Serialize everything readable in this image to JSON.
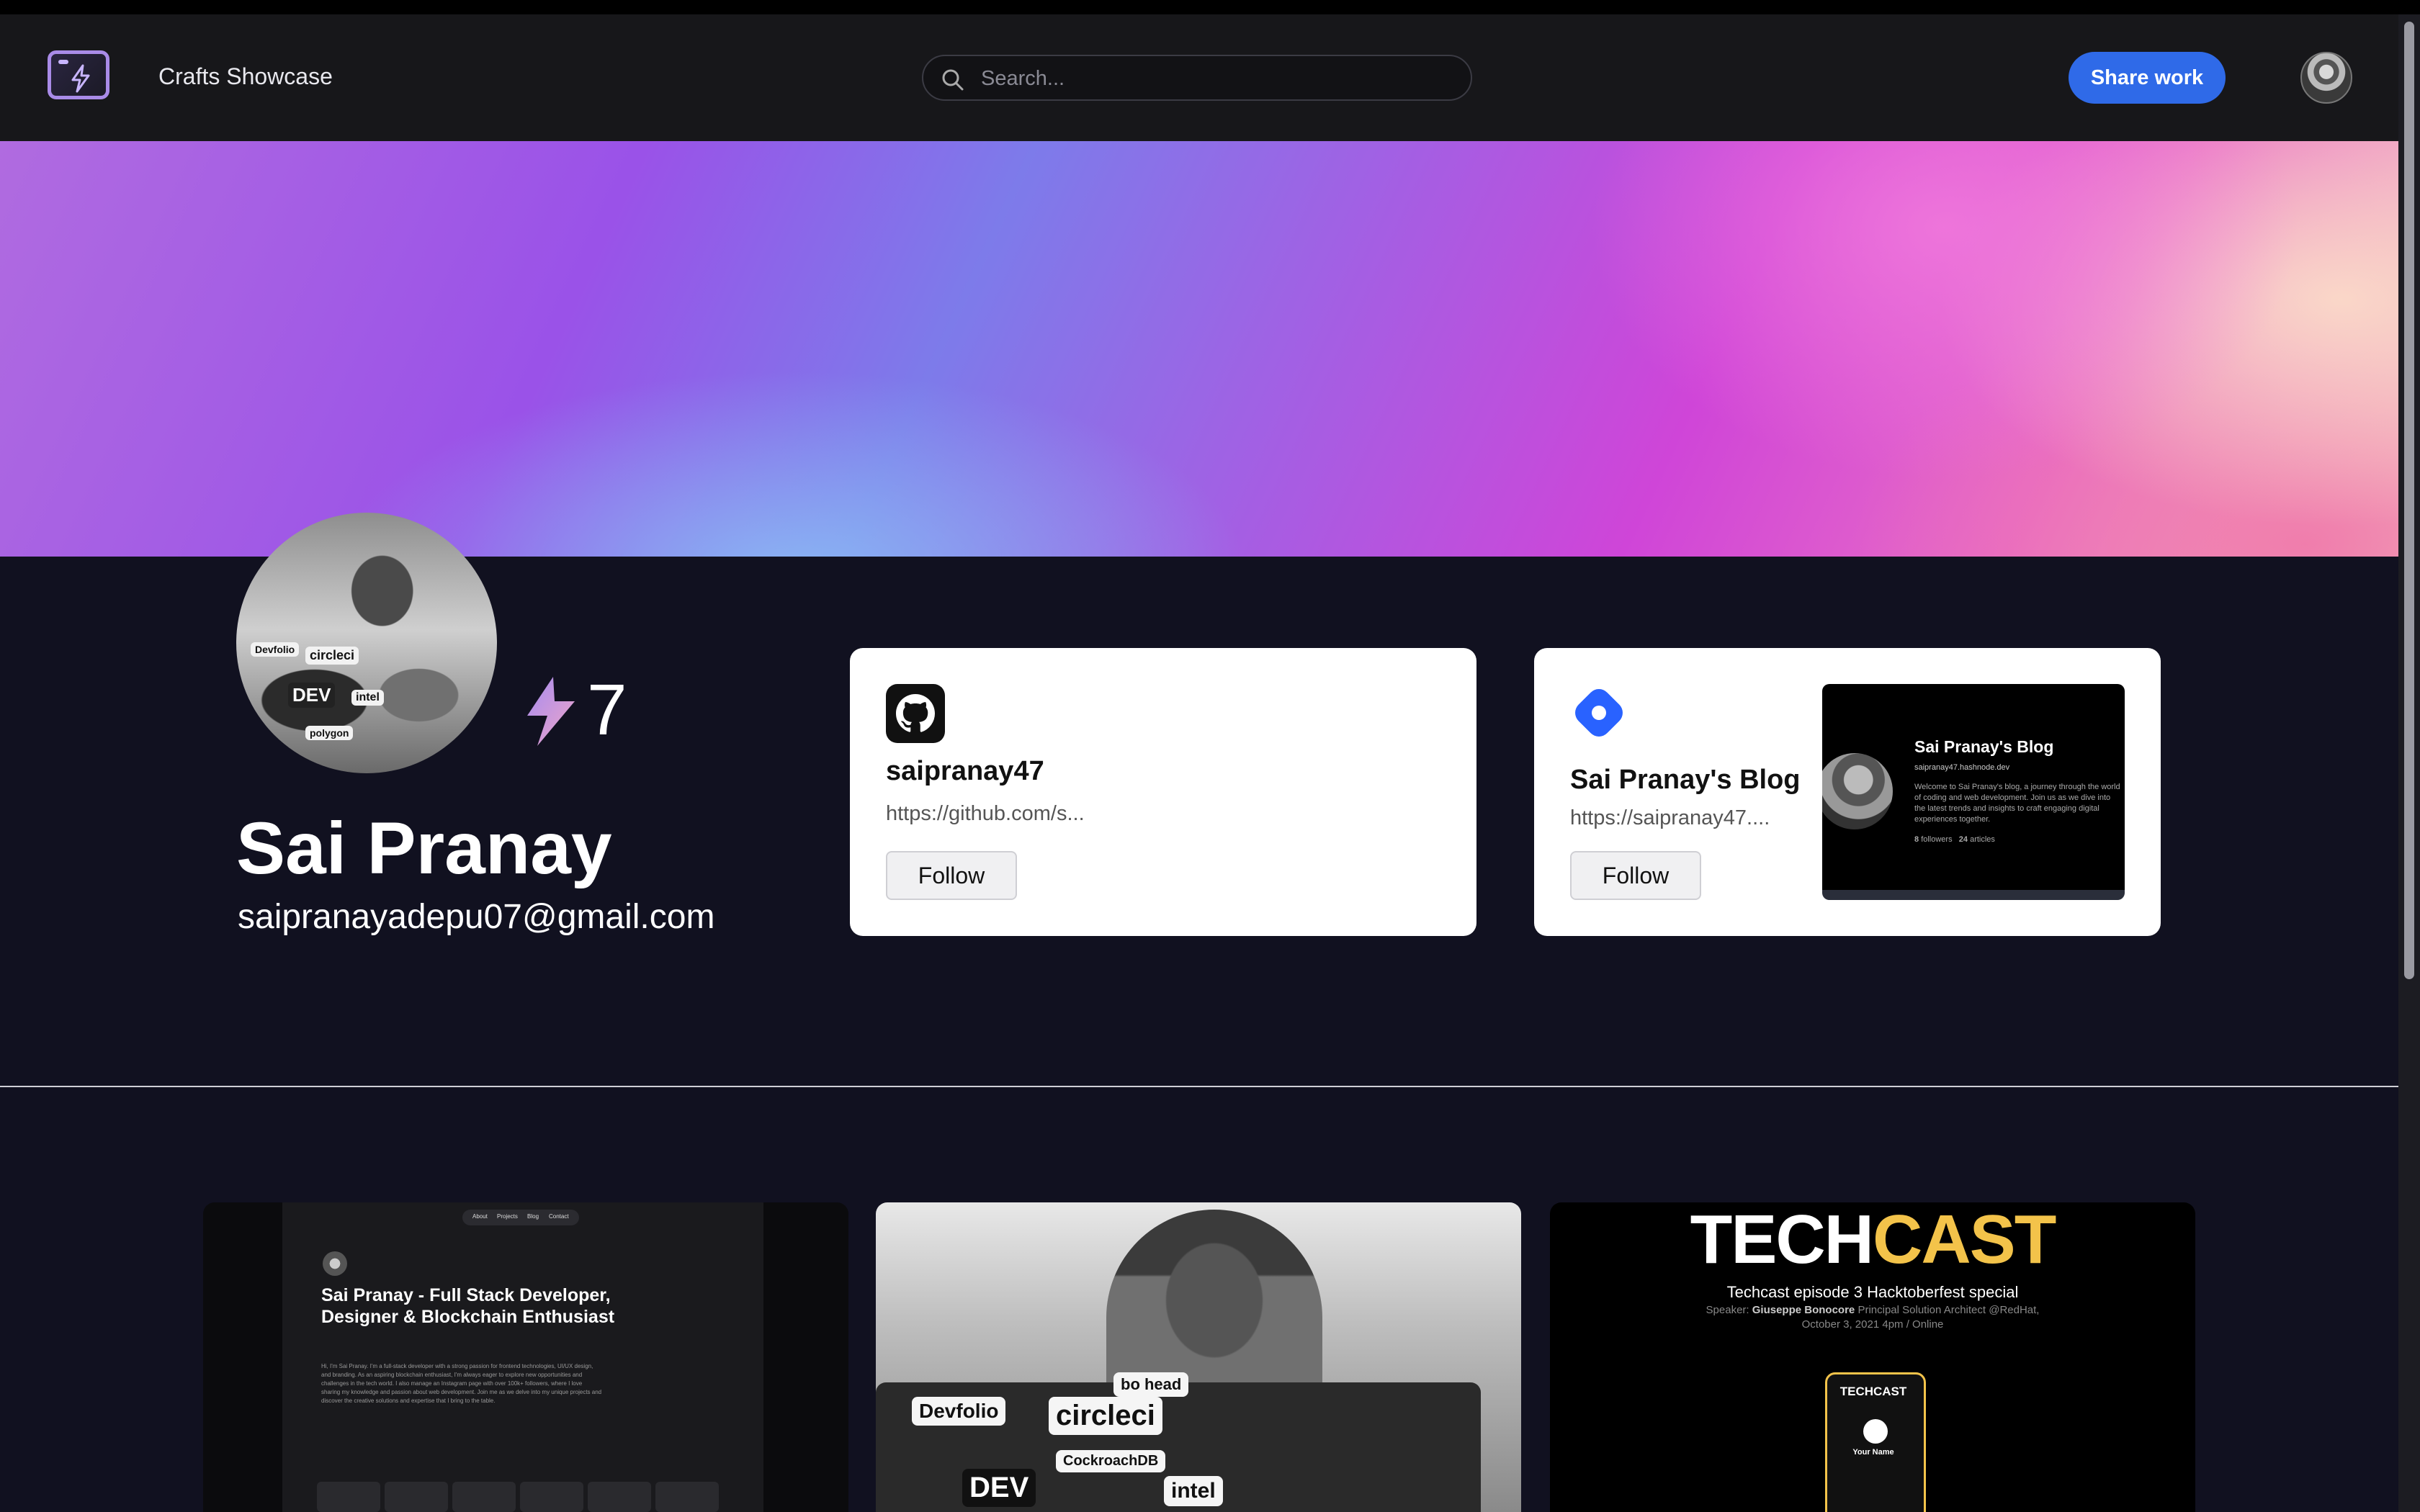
{
  "app": {
    "title": "Crafts Showcase"
  },
  "search": {
    "placeholder": "Search..."
  },
  "header": {
    "share_label": "Share work"
  },
  "profile": {
    "name": "Sai Pranay",
    "email": "saipranayadepu07@gmail.com",
    "karma": "7",
    "photo_stickers": [
      "Devfolio",
      "circleci",
      "DEV",
      "intel",
      "polygon"
    ]
  },
  "links": [
    {
      "title": "saipranay47",
      "url": "https://github.com/s...",
      "follow_label": "Follow",
      "icon": "github-icon"
    },
    {
      "title": "Sai Pranay's Blog",
      "url": "https://saipranay47....",
      "follow_label": "Follow",
      "icon": "hashnode-icon",
      "preview": {
        "title": "Sai Pranay's Blog",
        "domain": "saipranay47.hashnode.dev",
        "description": "Welcome to Sai Pranay's blog, a journey through the world of coding and web development. Join us as we dive into the latest trends and insights to craft engaging digital experiences together.",
        "followers_count": "8",
        "followers_label": "followers",
        "articles_count": "24",
        "articles_label": "articles"
      }
    }
  ],
  "projects": [
    {
      "nav": [
        "About",
        "Projects",
        "Blog",
        "Contact"
      ],
      "heading": "Sai Pranay - Full Stack Developer, Designer & Blockchain Enthusiast",
      "paragraph": "Hi, I'm Sai Pranay. I'm a full-stack developer with a strong passion for frontend technologies, UI/UX design, and branding. As an aspiring blockchain enthusiast, I'm always eager to explore new opportunities and challenges in the tech world. I also manage an Instagram page with over 100k+ followers, where I love sharing my knowledge and passion about web development. Join me as we delve into my unique projects and discover the creative solutions and expertise that I bring to the table."
    },
    {
      "stickers": [
        "Devfolio",
        "circleci",
        "CockroachDB",
        "DEV",
        "bo head",
        "intel"
      ]
    },
    {
      "title_white": "TECH",
      "title_yellow": "CAST",
      "subtitle": "Techcast episode 3 Hacktoberfest special",
      "speaker_label": "Speaker:",
      "speaker_name": "Giuseppe Bonocore",
      "speaker_role": "Principal Solution Architect @RedHat,",
      "date": "October 3, 2021 4pm / Online",
      "phone_title": "TECHCAST",
      "phone_name": "Your Name"
    }
  ],
  "colors": {
    "accent": "#2f6ae8",
    "techcast_yellow": "#f3c34a",
    "background": "#111120"
  }
}
